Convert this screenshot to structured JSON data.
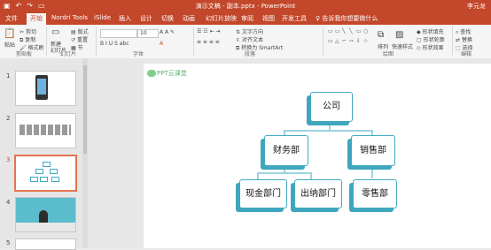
{
  "window": {
    "title": "演示文稿 - 副本.pptx  -  PowerPoint",
    "user": "李元龙",
    "qat_icons": [
      "save-icon",
      "undo-icon",
      "redo-icon",
      "present-icon"
    ]
  },
  "tabs": [
    "文件",
    "开始",
    "Nordri Tools",
    "iSlide",
    "插入",
    "设计",
    "切换",
    "动画",
    "幻灯片放映",
    "审阅",
    "视图",
    "开发工具"
  ],
  "tell_me": "告诉我你想要做什么",
  "ribbon": {
    "clipboard": {
      "paste": "粘贴",
      "cut": "剪切",
      "copy": "复制",
      "format_painter": "格式刷",
      "group": "剪贴板"
    },
    "slides": {
      "new_slide": "新建",
      "new_slide2": "幻灯片",
      "layout": "版式",
      "reset": "重置",
      "section": "节",
      "group": "幻灯片"
    },
    "font": {
      "size": "10",
      "group": "字体",
      "style_marks": "B I U S abc"
    },
    "paragraph": {
      "text_direction": "文字方向",
      "align_text": "对齐文本",
      "convert_smartart": "转换为 SmartArt",
      "group": "段落"
    },
    "drawing": {
      "arrange": "排列",
      "quick_styles": "快速样式",
      "shape_fill": "形状填充",
      "shape_outline": "形状轮廓",
      "shape_effects": "形状效果",
      "group": "绘图"
    },
    "editing": {
      "find": "查找",
      "replace": "替换",
      "select": "选择",
      "group": "编辑"
    }
  },
  "slides_pane": {
    "numbers": [
      "1",
      "2",
      "3",
      "4",
      "5"
    ],
    "selected": "3"
  },
  "slide": {
    "logo_text": "PPT云课堂",
    "org_chart": {
      "root": "公司",
      "level2": [
        "财务部",
        "销售部"
      ],
      "level3": [
        "现金部门",
        "出纳部门",
        "零售部"
      ]
    }
  },
  "colors": {
    "accent": "#c3472a",
    "node_border": "#40a9bf",
    "node_shadow": "#3ea6bd",
    "selection": "#e4744f"
  }
}
